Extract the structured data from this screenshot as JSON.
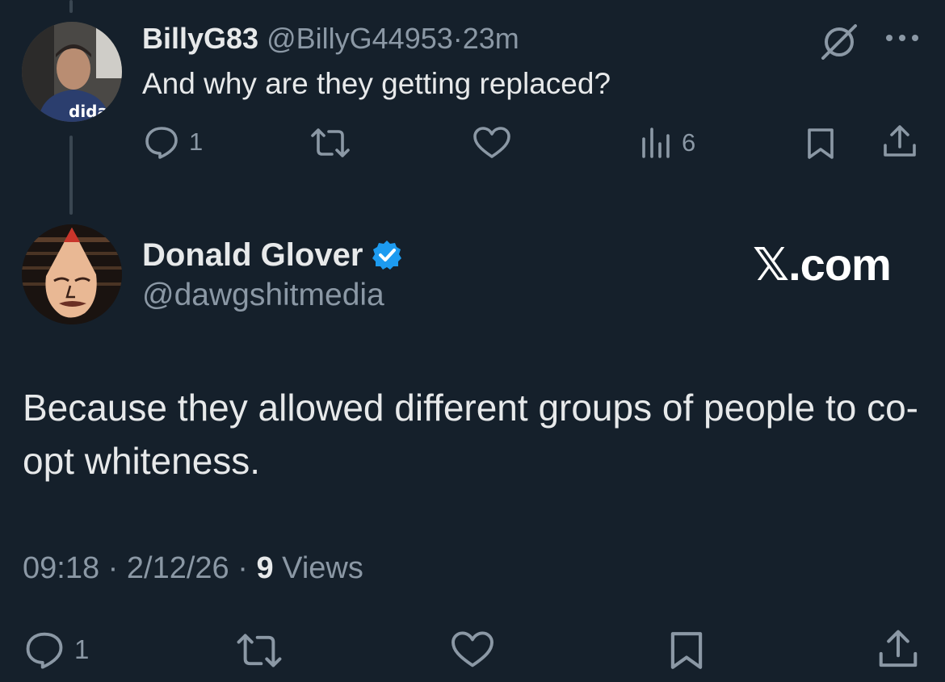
{
  "reply": {
    "display_name": "BillyG83",
    "handle": "@BillyG44953",
    "separator": "·",
    "time": "23m",
    "text": "And why are they getting replaced?",
    "reply_count": "1",
    "view_count": "6",
    "avatar_text": "didas"
  },
  "post": {
    "display_name": "Donald Glover",
    "handle": "@dawgshitmedia",
    "brand": "𝕏.com",
    "text": "Because they allowed different groups of people to co-opt whiteness.",
    "time": "09:18",
    "date": "2/12/26",
    "separator": "·",
    "views_count": "9",
    "views_label": "Views",
    "reply_count": "1"
  },
  "colors": {
    "background": "#15202b",
    "text": "#e7e9ea",
    "muted": "#8b98a5",
    "verified": "#1d9bf0"
  },
  "icons": {
    "reply": "reply-icon",
    "repost": "repost-icon",
    "like": "heart-icon",
    "views": "bar-chart-icon",
    "bookmark": "bookmark-icon",
    "share": "share-icon",
    "grok": "grok-icon",
    "more": "more-icon",
    "verified": "verified-badge-icon"
  }
}
